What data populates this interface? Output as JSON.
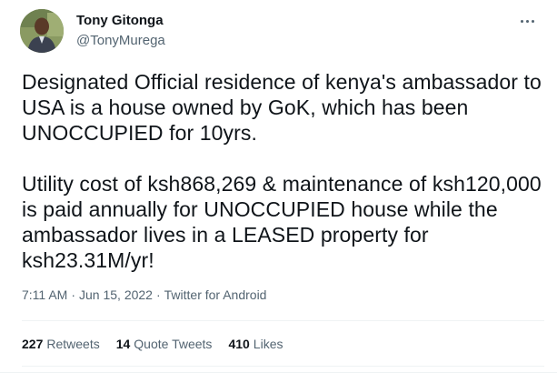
{
  "author": {
    "display_name": "Tony Gitonga",
    "handle": "@TonyMurega",
    "avatar_icon": "profile-photo"
  },
  "more_icon": "more-horizontal-icon",
  "tweet": {
    "paragraph_1": "Designated Official residence of kenya's ambassador to USA is a house owned by GoK, which has been UNOCCUPIED for 10yrs.",
    "paragraph_2": "Utility cost of ksh868,269 & maintenance of ksh120,000 is paid annually for UNOCCUPIED house while the ambassador lives in a LEASED property for ksh23.31M/yr!"
  },
  "meta": {
    "time": "7:11 AM",
    "separator": "·",
    "date": "Jun 15, 2022",
    "source": "Twitter for Android"
  },
  "stats": {
    "retweets_count": "227",
    "retweets_label": "Retweets",
    "quotes_count": "14",
    "quotes_label": "Quote Tweets",
    "likes_count": "410",
    "likes_label": "Likes"
  },
  "colors": {
    "primary_text": "#0f1419",
    "secondary_text": "#536471",
    "divider": "#eff3f4"
  }
}
